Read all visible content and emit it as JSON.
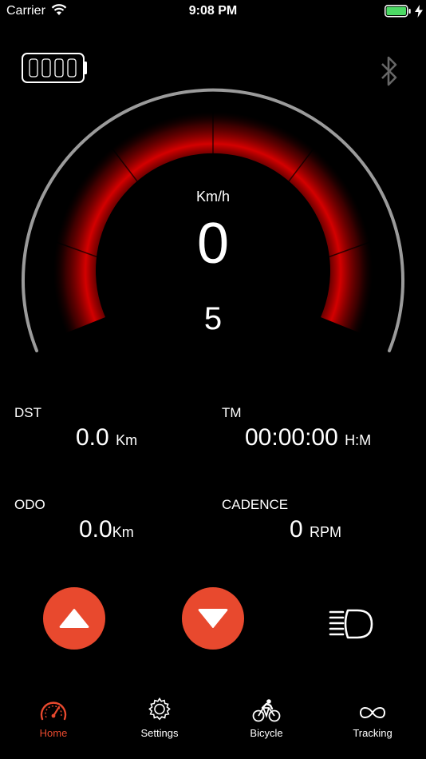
{
  "status_bar": {
    "carrier": "Carrier",
    "time": "9:08 PM"
  },
  "colors": {
    "accent": "#e8492e",
    "gauge_red": "#c00000",
    "background": "#000000"
  },
  "dashboard": {
    "bluetooth_icon": "bluetooth-icon",
    "bike_battery_icon": "battery-icon",
    "speed_unit": "Km/h",
    "speed": "0",
    "assist_level": "5"
  },
  "stats": {
    "dst": {
      "label": "DST",
      "value": "0.0",
      "unit": "Km"
    },
    "tm": {
      "label": "TM",
      "value": "00:00:00",
      "unit": "H:M"
    },
    "odo": {
      "label": "ODO",
      "value": "0.0",
      "unit": "Km"
    },
    "cadence": {
      "label": "CADENCE",
      "value": "0",
      "unit": "RPM"
    }
  },
  "controls": {
    "up_icon": "triangle-up-icon",
    "down_icon": "triangle-down-icon",
    "light_icon": "headlight-icon"
  },
  "tabs": [
    {
      "label": "Home",
      "icon": "speedometer-icon",
      "active": true
    },
    {
      "label": "Settings",
      "icon": "gear-icon",
      "active": false
    },
    {
      "label": "Bicycle",
      "icon": "cyclist-icon",
      "active": false
    },
    {
      "label": "Tracking",
      "icon": "infinity-icon",
      "active": false
    }
  ]
}
